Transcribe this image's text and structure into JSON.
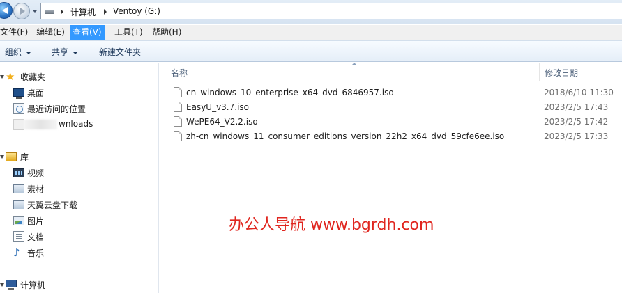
{
  "address": {
    "breadcrumb": [
      "计算机",
      "Ventoy (G:)"
    ]
  },
  "menubar": {
    "items": [
      {
        "label": "文件(F)"
      },
      {
        "label": "编辑(E)"
      },
      {
        "label": "查看(V)",
        "active": true
      },
      {
        "label": "工具(T)"
      },
      {
        "label": "帮助(H)"
      }
    ]
  },
  "toolbar": {
    "organize": "组织",
    "share": "共享",
    "new_folder": "新建文件夹"
  },
  "navpane": {
    "favorites": {
      "label": "收藏夹",
      "items": [
        {
          "label": "桌面",
          "icon": "desktop-icon"
        },
        {
          "label": "最近访问的位置",
          "icon": "recent-places-icon"
        },
        {
          "label": "wnloads",
          "icon": "downloads-icon"
        }
      ]
    },
    "libraries": {
      "label": "库",
      "items": [
        {
          "label": "视频",
          "icon": "videos-icon"
        },
        {
          "label": "素材",
          "icon": "folder-icon"
        },
        {
          "label": "天翼云盘下载",
          "icon": "folder-icon"
        },
        {
          "label": "图片",
          "icon": "pictures-icon"
        },
        {
          "label": "文档",
          "icon": "documents-icon"
        },
        {
          "label": "音乐",
          "icon": "music-icon"
        }
      ]
    },
    "computer": {
      "label": "计算机"
    }
  },
  "list": {
    "columns": {
      "name": "名称",
      "date": "修改日期"
    },
    "files": [
      {
        "name": "cn_windows_10_enterprise_x64_dvd_6846957.iso",
        "date": "2018/6/10 11:30"
      },
      {
        "name": "EasyU_v3.7.iso",
        "date": "2023/2/5 17:43"
      },
      {
        "name": "WePE64_V2.2.iso",
        "date": "2023/2/5 17:42"
      },
      {
        "name": "zh-cn_windows_11_consumer_editions_version_22h2_x64_dvd_59cfe6ee.iso",
        "date": "2023/2/5 17:33"
      }
    ]
  },
  "watermark": "办公人导航  www.bgrdh.com",
  "colors": {
    "menu_active": "#3399ff",
    "watermark": "#e0261f"
  }
}
